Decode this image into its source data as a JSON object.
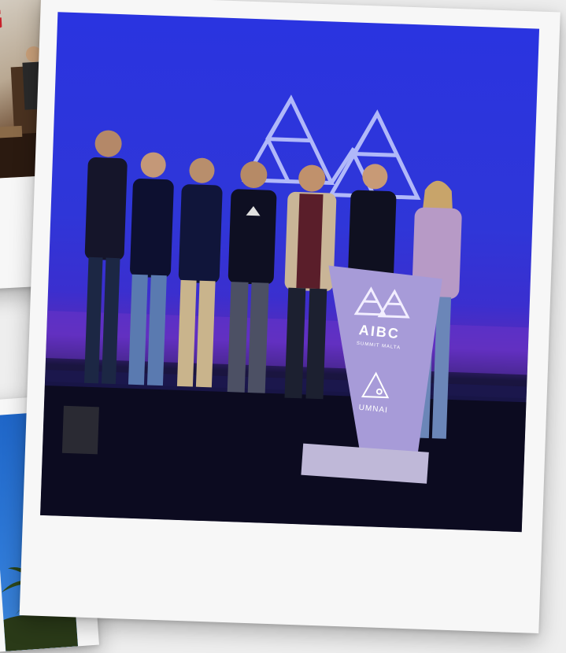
{
  "photos": {
    "main": {
      "podium_brand": "AIBC",
      "podium_subtitle": "SUMMIT MALTA",
      "sponsor": "UMNAI"
    }
  },
  "colors": {
    "stage_blue": "#2f36d8",
    "stage_purple": "#5a2ab8",
    "podium_lilac": "#a79bd8",
    "polaroid_frame": "#f7f7f7",
    "page_bg": "#eeeeee"
  },
  "icons": [
    "aibc-logo-icon",
    "umnai-logo-icon",
    "triangle-stage-logo-icon"
  ]
}
